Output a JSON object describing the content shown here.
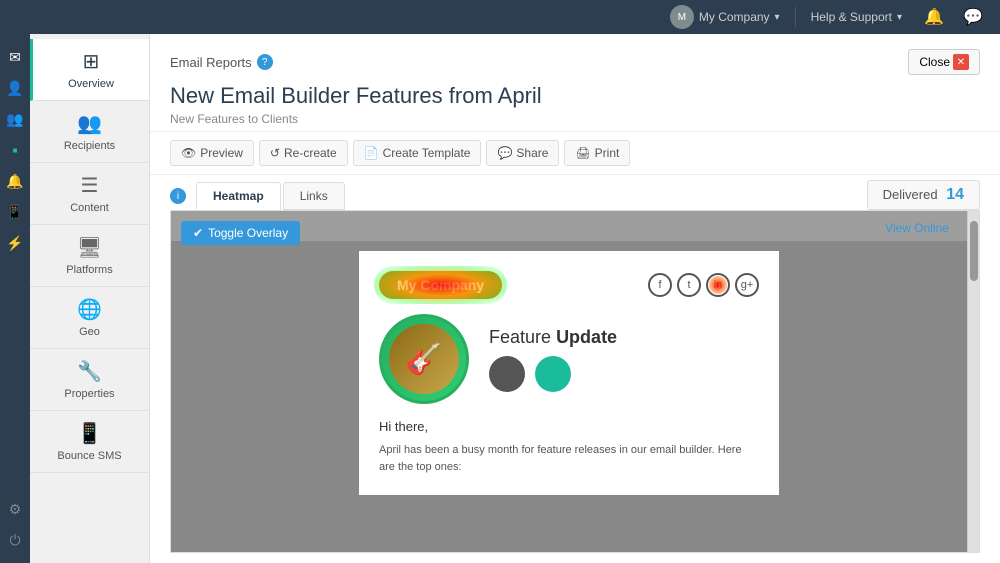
{
  "topnav": {
    "company_label": "My Company",
    "help_label": "Help & Support",
    "dropdown_arrow": "▾",
    "avatar_initials": "M"
  },
  "sidebar_thin": {
    "icons": [
      {
        "name": "mail-icon",
        "symbol": "✉"
      },
      {
        "name": "user-icon",
        "symbol": "👤"
      },
      {
        "name": "team-icon",
        "symbol": "👥"
      },
      {
        "name": "active-icon",
        "symbol": "▪"
      },
      {
        "name": "bell-icon",
        "symbol": "🔔"
      },
      {
        "name": "phone-icon",
        "symbol": "📱"
      },
      {
        "name": "layers-icon",
        "symbol": "⚡"
      },
      {
        "name": "settings-icon",
        "symbol": "⚙"
      },
      {
        "name": "power-icon",
        "symbol": "⏻"
      }
    ]
  },
  "sidebar_main": {
    "items": [
      {
        "id": "overview",
        "label": "Overview",
        "icon": "⊞",
        "active": true
      },
      {
        "id": "recipients",
        "label": "Recipients",
        "icon": "👥"
      },
      {
        "id": "content",
        "label": "Content",
        "icon": "☰"
      },
      {
        "id": "platforms",
        "label": "Platforms",
        "icon": "🖥"
      },
      {
        "id": "geo",
        "label": "Geo",
        "icon": "🌐"
      },
      {
        "id": "properties",
        "label": "Properties",
        "icon": "🔧"
      },
      {
        "id": "bounce-sms",
        "label": "Bounce SMS",
        "icon": "📱"
      }
    ]
  },
  "page": {
    "title": "Email Reports",
    "email_title": "New Email Builder Features from April",
    "email_subtitle": "New Features to Clients",
    "close_label": "Close"
  },
  "toolbar": {
    "preview_label": "Preview",
    "recreate_label": "Re-create",
    "create_template_label": "Create Template",
    "share_label": "Share",
    "print_label": "Print"
  },
  "tabs": {
    "heatmap_label": "Heatmap",
    "links_label": "Links"
  },
  "delivered": {
    "label": "Delivered",
    "count": "14"
  },
  "preview": {
    "toggle_overlay_label": "Toggle Overlay",
    "view_online_label": "View Online",
    "logo_text": "My Company",
    "social_icons": [
      "f",
      "t",
      "in",
      "g+"
    ],
    "feature_title_light": "Feature",
    "feature_title_bold": "Update",
    "hi_there": "Hi there,",
    "body_text": "April has been a busy month for feature releases in our email builder. Here are the top ones:",
    "guitar_emoji": "🎸"
  }
}
